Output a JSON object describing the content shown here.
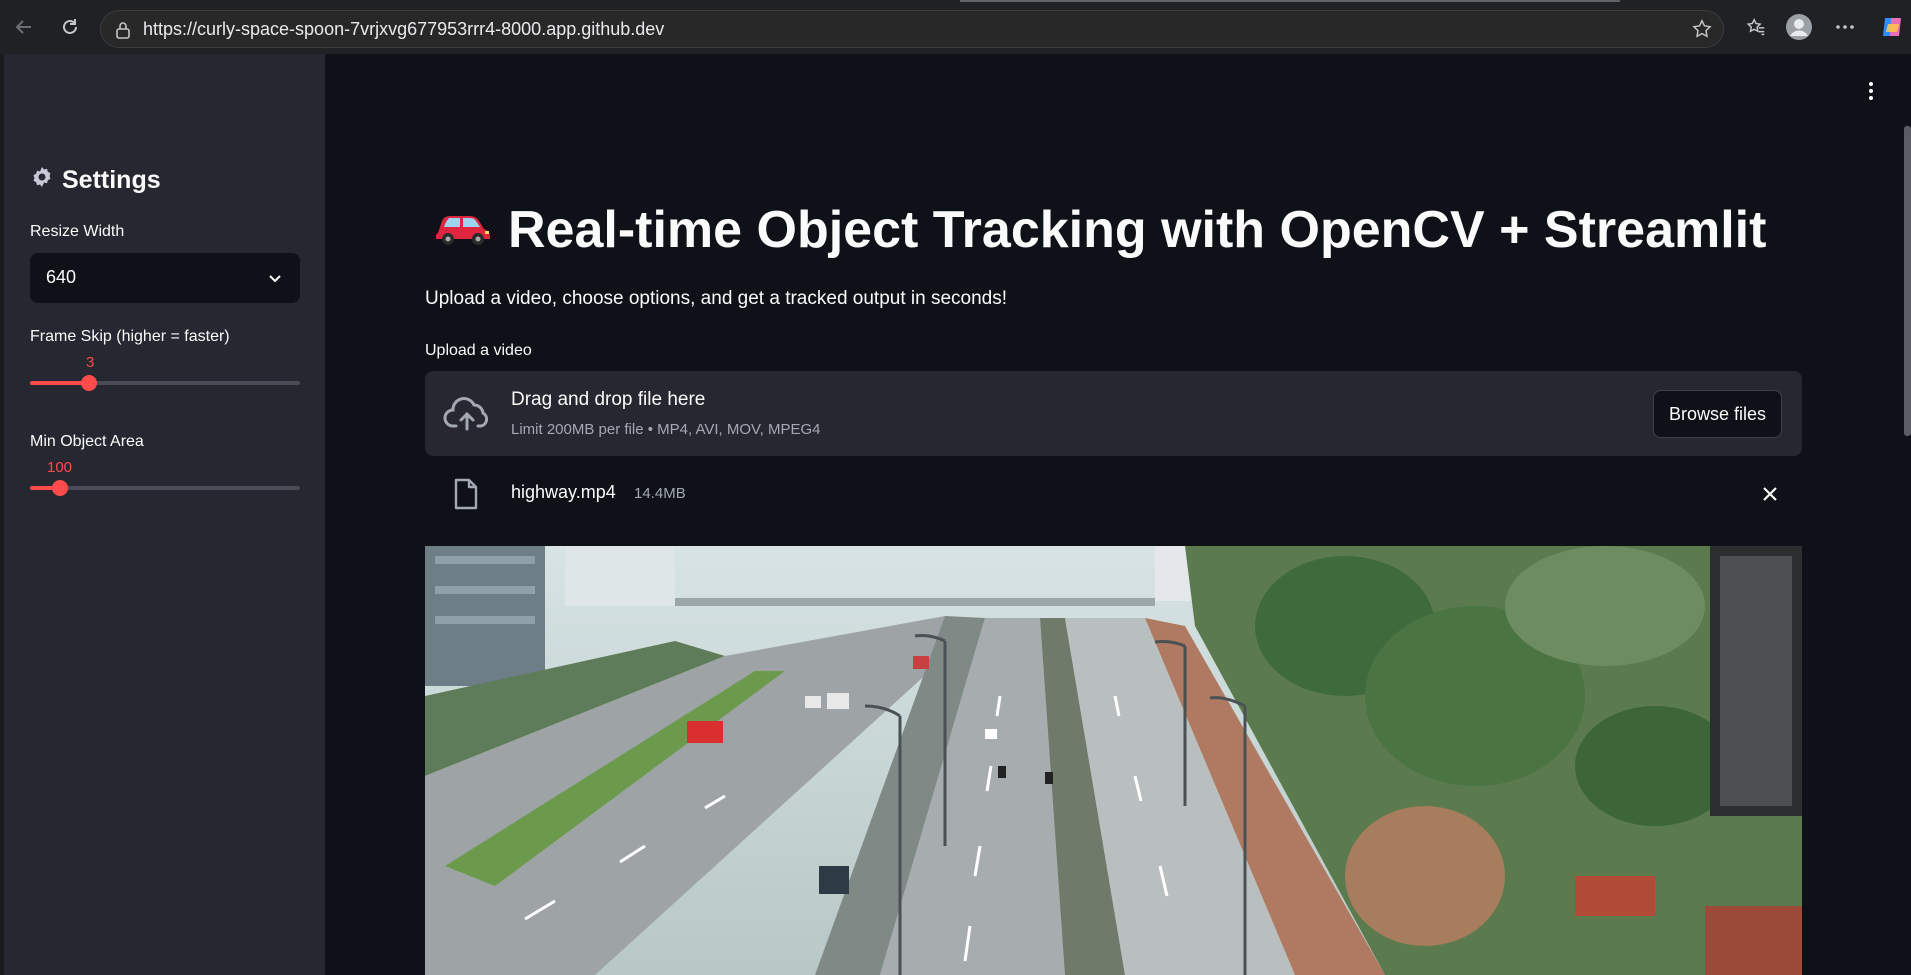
{
  "browser": {
    "url": "https://curly-space-spoon-7vrjxvg677953rrr4-8000.app.github.dev"
  },
  "sidebar": {
    "title": "Settings",
    "resize_width": {
      "label": "Resize Width",
      "value": "640"
    },
    "frame_skip": {
      "label": "Frame Skip (higher = faster)",
      "value": "3",
      "fraction": 0.22
    },
    "min_area": {
      "label": "Min Object Area",
      "value": "100",
      "fraction": 0.11
    }
  },
  "main": {
    "title": "Real-time Object Tracking with OpenCV + Streamlit",
    "title_emoji": "car",
    "subtitle": "Upload a video, choose options, and get a tracked output in seconds!",
    "uploader": {
      "label": "Upload a video",
      "drop_text": "Drag and drop file here",
      "limit_text": "Limit 200MB per file • MP4, AVI, MOV, MPEG4",
      "browse_label": "Browse files"
    },
    "file": {
      "name": "highway.mp4",
      "size": "14.4MB"
    }
  },
  "colors": {
    "accent": "#ff4b4b",
    "sidebar_bg": "#262730",
    "main_bg": "#0e1117"
  }
}
